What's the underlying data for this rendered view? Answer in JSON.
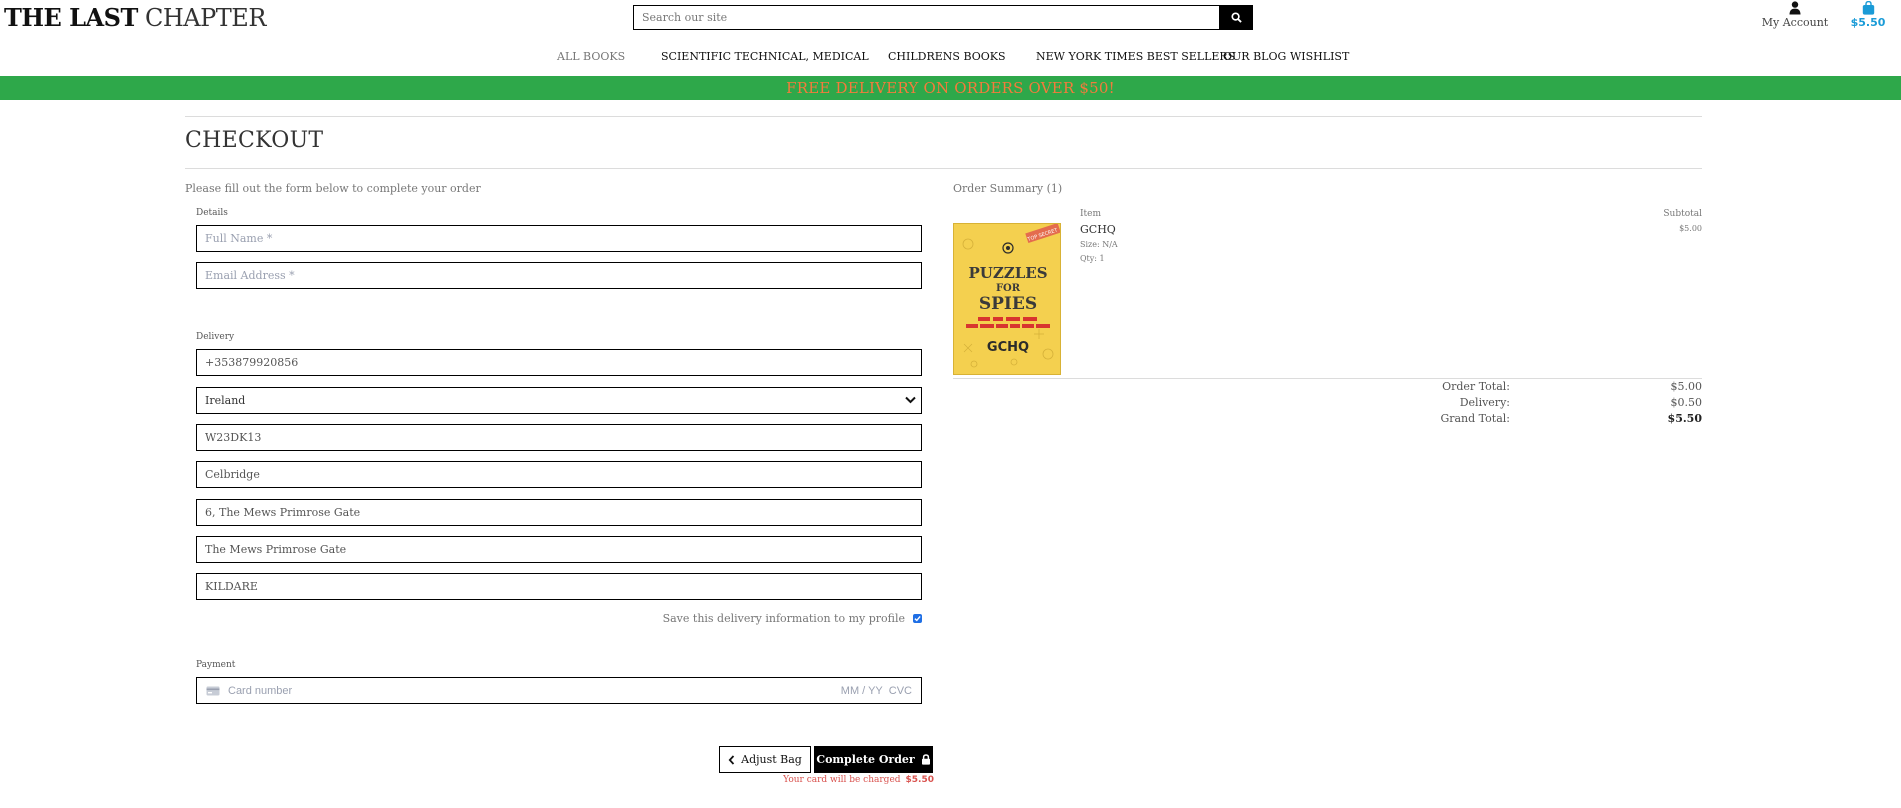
{
  "brand": {
    "part1": "THE LAST",
    "part2": "CHAPTER"
  },
  "search": {
    "placeholder": "Search our site"
  },
  "account": {
    "label": "My Account"
  },
  "bag": {
    "total": "$5.50"
  },
  "nav": {
    "items": [
      {
        "label": "ALL BOOKS"
      },
      {
        "label": "SCIENTIFIC TECHNICAL, MEDICAL"
      },
      {
        "label": "CHILDRENS BOOKS"
      },
      {
        "label": "NEW YORK TIMES BEST SELLERS"
      },
      {
        "label": "OUR BLOG"
      },
      {
        "label": "WISHLIST"
      }
    ]
  },
  "banner": {
    "text": "FREE DELIVERY ON ORDERS OVER $50!"
  },
  "checkout": {
    "title": "CHECKOUT",
    "intro": "Please fill out the form below to complete your order",
    "details_legend": "Details",
    "full_name_placeholder": "Full Name *",
    "email_placeholder": "Email Address *",
    "delivery_legend": "Delivery",
    "phone": "+353879920856",
    "country": "Ireland",
    "postcode": "W23DK13",
    "town": "Celbridge",
    "street1": "6, The Mews Primrose Gate",
    "street2": "The Mews Primrose Gate",
    "county": "KILDARE",
    "save_info_label": "Save this delivery information to my profile",
    "save_info_checked": true,
    "payment_legend": "Payment",
    "card_placeholder": "Card number",
    "card_expiry_placeholder": "MM / YY",
    "card_cvc_placeholder": "CVC",
    "adjust_bag_label": "Adjust Bag",
    "complete_order_label": "Complete Order",
    "charge_note": "Your card will be charged",
    "charge_amount": "$5.50"
  },
  "summary": {
    "heading": "Order Summary (1)",
    "col_item": "Item",
    "col_subtotal": "Subtotal",
    "item": {
      "name": "GCHQ",
      "size": "Size: N/A",
      "qty": "Qty: 1",
      "subtotal": "$5.00",
      "cover": {
        "title_line1": "PUZZLES",
        "title_line2": "FOR",
        "title_line3": "SPIES",
        "author": "GCHQ",
        "sticker": "TOP SECRET"
      }
    },
    "order_total_label": "Order Total:",
    "order_total": "$5.00",
    "delivery_label": "Delivery:",
    "delivery": "$0.50",
    "grand_total_label": "Grand Total:",
    "grand_total": "$5.50"
  },
  "colors": {
    "banner_bg": "#2ea84a",
    "banner_text": "#f37b3c",
    "bag_accent": "#1a9bd7",
    "error_red": "#d9534f",
    "checkbox_blue": "#1f6fe5"
  }
}
